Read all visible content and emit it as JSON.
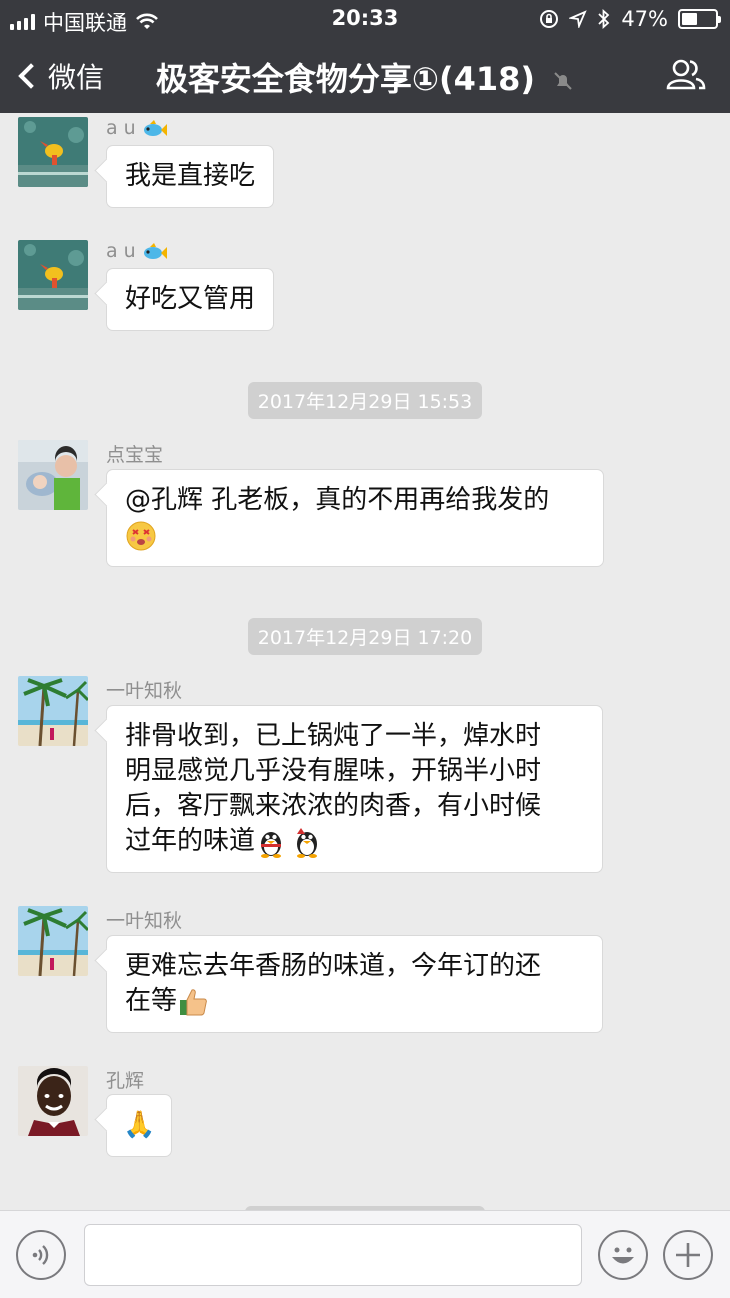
{
  "status_bar": {
    "carrier": "中国联通",
    "time": "20:33",
    "battery": "47%",
    "battery_level": 0.47
  },
  "nav": {
    "back_label": "微信",
    "title": "极客安全食物分享①(418)"
  },
  "messages": [
    {
      "sender": "a u",
      "text": "我是直接吃"
    },
    {
      "sender": "a u",
      "text": "好吃又管用"
    },
    {
      "timestamp": "2017年12月29日 15:53"
    },
    {
      "sender": "点宝宝",
      "text": "@孔辉 孔老板，真的不用再给我发的"
    },
    {
      "timestamp": "2017年12月29日 17:20"
    },
    {
      "sender": "一叶知秋",
      "line1": "排骨收到，已上锅炖了一半，焯水时",
      "line2": "明显感觉几乎没有腥味，开锅半小时",
      "line3": "后，客厅飘来浓浓的肉香，有小时候",
      "line4": "过年的味道"
    },
    {
      "sender": "一叶知秋",
      "line1": "更难忘去年香肠的味道，今年订的还",
      "line2": "在等"
    },
    {
      "sender": "孔辉",
      "emoji": "🙏"
    }
  ],
  "icons": {
    "fish": "fish-emoji-icon",
    "dizzy": "dizzy-face-emoji-icon",
    "penguin": "penguin-emoji-icon",
    "thumbs_up": "thumbs-up-emoji-icon",
    "voice": "voice-input-icon",
    "smiley": "emoji-picker-icon",
    "plus": "more-actions-icon",
    "people": "group-members-icon"
  },
  "colors": {
    "nav_bg": "#393a3f",
    "chat_bg": "#ebebeb",
    "timestamp_bg": "#d0d0d0"
  }
}
